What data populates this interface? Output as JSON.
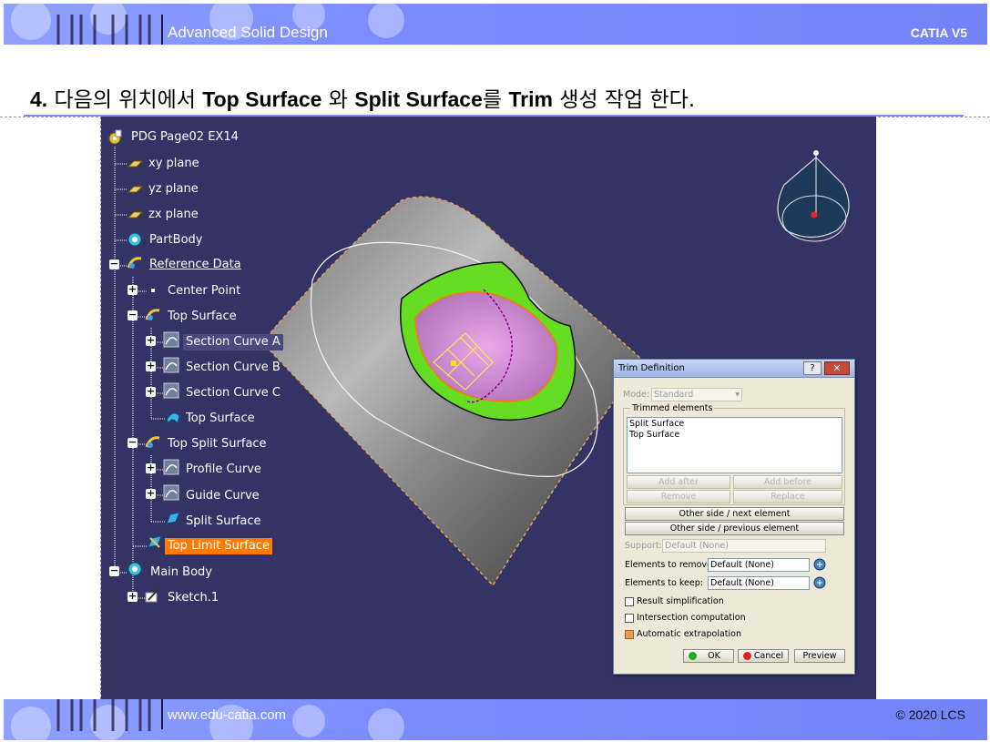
{
  "header": {
    "left_title": "Advanced Solid Design",
    "right_title": "CATIA V5"
  },
  "footer": {
    "url": "www.edu-catia.com",
    "copyright": "© 2020 LCS"
  },
  "step": {
    "number": "4.",
    "t1": " 다음의 위치에서 ",
    "b1": "Top Surface",
    "t2": " 와 ",
    "b2": "Split Surface",
    "t3": "를 ",
    "b3": "Trim",
    "t4": " 생성 작업 한다."
  },
  "tree": {
    "root": "PDG Page02 EX14",
    "xy": "xy plane",
    "yz": "yz plane",
    "zx": "zx plane",
    "partbody": "PartBody",
    "refdata": "Reference Data",
    "center": "Center Point",
    "topsurf_set": "Top Surface",
    "sca": "Section Curve A",
    "scb": "Section Curve B",
    "scc": "Section Curve C",
    "topsurf": "Top Surface",
    "topsplit_set": "Top Split Surface",
    "profile": "Profile Curve",
    "guide": "Guide Curve",
    "split": "Split Surface",
    "toplimit": "Top Limit Surface",
    "mainbody": "Main Body",
    "sketch": "Sketch.1"
  },
  "viewport": {
    "bg": "#333366"
  },
  "dialog": {
    "title": "Trim Definition",
    "help": "?",
    "close": "✕",
    "mode_label": "Mode:",
    "mode_value": "Standard",
    "trimmed_label": "Trimmed elements",
    "trimmed_items": [
      "Split Surface",
      "Top Surface"
    ],
    "add_after": "Add after",
    "add_before": "Add before",
    "remove": "Remove",
    "replace": "Replace",
    "other_next": "Other side / next element",
    "other_prev": "Other side / previous element",
    "support_label": "Support:",
    "support_value": "Default (None)",
    "remove_label": "Elements to remove:",
    "remove_value": "Default (None)",
    "keep_label": "Elements to keep:",
    "keep_value": "Default (None)",
    "opt_simplification": "Result simplification",
    "opt_intersection": "Intersection computation",
    "opt_extrapolation": "Automatic extrapolation",
    "ok": "OK",
    "cancel": "Cancel",
    "preview": "Preview"
  }
}
